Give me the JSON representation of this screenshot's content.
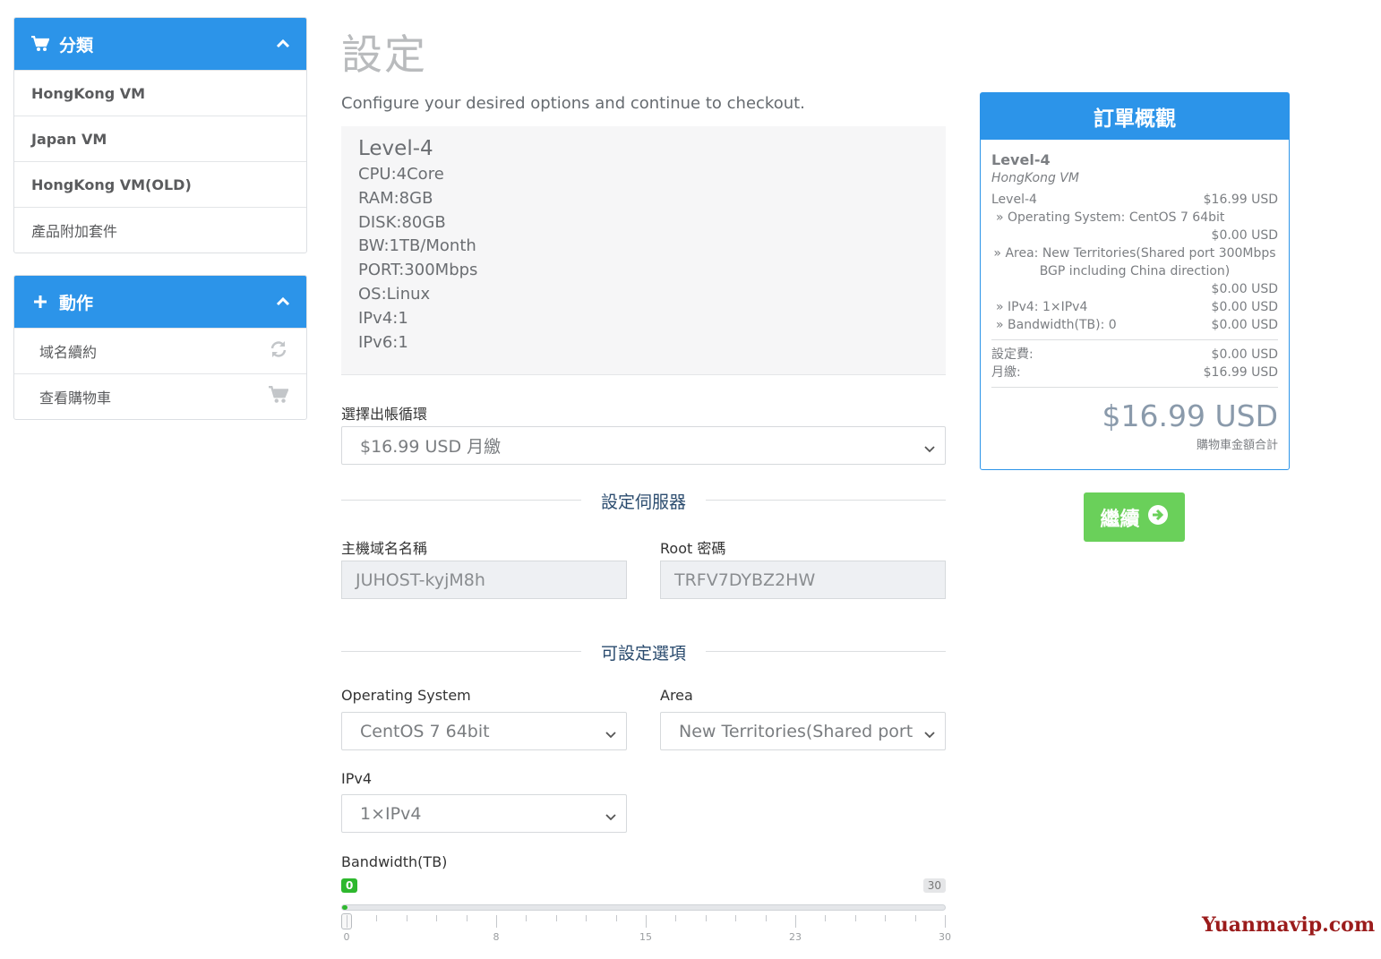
{
  "sidebar": {
    "categories": {
      "title": "分類",
      "items": [
        "HongKong VM",
        "Japan VM",
        "HongKong VM(OLD)",
        "產品附加套件"
      ]
    },
    "actions": {
      "title": "動作",
      "items": [
        {
          "label": "域名續約",
          "icon": "refresh-icon"
        },
        {
          "label": "查看購物車",
          "icon": "cart-icon"
        }
      ]
    }
  },
  "main": {
    "title": "設定",
    "subtitle": "Configure your desired options and continue to checkout.",
    "product": {
      "name": "Level-4",
      "specs": [
        "CPU:4Core",
        "RAM:8GB",
        "DISK:80GB",
        "BW:1TB/Month",
        "PORT:300Mbps",
        "OS:Linux",
        "IPv4:1",
        "IPv6:1"
      ]
    },
    "billing": {
      "label": "選擇出帳循環",
      "selected": "$16.99 USD 月繳"
    },
    "server_section": {
      "heading": "設定伺服器",
      "hostname_label": "主機域名名稱",
      "hostname_value": "JUHOST-kyjM8h",
      "root_label": "Root 密碼",
      "root_value": "TRFV7DYBZ2HW"
    },
    "options_section": {
      "heading": "可設定選項",
      "os_label": "Operating System",
      "os_value": "CentOS 7 64bit",
      "area_label": "Area",
      "area_value": "New Territories(Shared port",
      "ipv4_label": "IPv4",
      "ipv4_value": "1×IPv4",
      "bandwidth_label": "Bandwidth(TB)",
      "bandwidth": {
        "min": 0,
        "max": 30,
        "value": 0,
        "min_label": "0",
        "max_label": "30",
        "tick_labels": [
          "0",
          "8",
          "15",
          "23",
          "30"
        ]
      }
    }
  },
  "summary": {
    "title": "訂單概觀",
    "product_name": "Level-4",
    "product_group": "HongKong VM",
    "line_name": "Level-4",
    "line_price": "$16.99 USD",
    "os_line": "» Operating System: CentOS 7 64bit",
    "os_price": "$0.00 USD",
    "area_line1": "» Area: New Territories(Shared port 300Mbps",
    "area_line2": "BGP including China direction)",
    "area_price": "$0.00 USD",
    "ipv4_line": "» IPv4: 1×IPv4",
    "ipv4_price": "$0.00 USD",
    "bw_line": "» Bandwidth(TB): 0",
    "bw_price": "$0.00 USD",
    "setup_label": "設定費:",
    "setup_price": "$0.00 USD",
    "monthly_label": "月繳:",
    "monthly_price": "$16.99 USD",
    "total": "$16.99 USD",
    "total_label": "購物車金額合計"
  },
  "continue_label": "繼續",
  "watermark": "Yuanmavip.com",
  "colors": {
    "primary": "#2c94e9",
    "success": "#6ad05a",
    "slider_green": "#2eb82e"
  }
}
